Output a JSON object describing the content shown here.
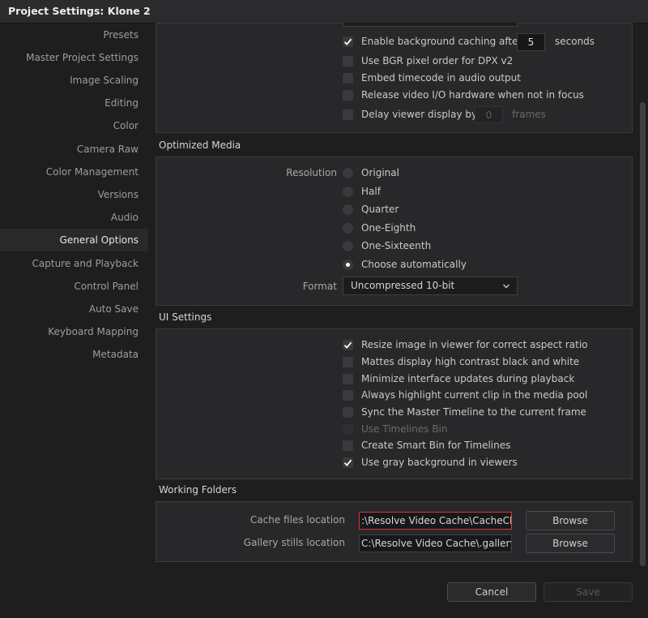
{
  "window": {
    "title": "Project Settings:  Klone 2"
  },
  "sidebar": {
    "items": [
      {
        "label": "Presets",
        "active": false
      },
      {
        "label": "Master Project Settings",
        "active": false
      },
      {
        "label": "Image Scaling",
        "active": false
      },
      {
        "label": "Editing",
        "active": false
      },
      {
        "label": "Color",
        "active": false
      },
      {
        "label": "Camera Raw",
        "active": false
      },
      {
        "label": "Color Management",
        "active": false
      },
      {
        "label": "Versions",
        "active": false
      },
      {
        "label": "Audio",
        "active": false
      },
      {
        "label": "General Options",
        "active": true
      },
      {
        "label": "Capture and Playback",
        "active": false
      },
      {
        "label": "Control Panel",
        "active": false
      },
      {
        "label": "Auto Save",
        "active": false
      },
      {
        "label": "Keyboard Mapping",
        "active": false
      },
      {
        "label": "Metadata",
        "active": false
      }
    ]
  },
  "general": {
    "bg_caching": {
      "label": "Enable background caching after",
      "checked": true,
      "value": "5",
      "unit": "seconds"
    },
    "bgr_order": {
      "label": "Use BGR pixel order for DPX v2",
      "checked": false
    },
    "embed_tc": {
      "label": "Embed timecode in audio output",
      "checked": false
    },
    "release_io": {
      "label": "Release video I/O hardware when not in focus",
      "checked": false
    },
    "delay_viewer": {
      "label": "Delay viewer display by",
      "checked": false,
      "value": "0",
      "unit": "frames"
    }
  },
  "optimized_media": {
    "title": "Optimized Media",
    "resolution_label": "Resolution",
    "options": [
      {
        "label": "Original",
        "checked": false
      },
      {
        "label": "Half",
        "checked": false
      },
      {
        "label": "Quarter",
        "checked": false
      },
      {
        "label": "One-Eighth",
        "checked": false
      },
      {
        "label": "One-Sixteenth",
        "checked": false
      },
      {
        "label": "Choose automatically",
        "checked": true
      }
    ],
    "format_label": "Format",
    "format_value": "Uncompressed 10-bit"
  },
  "ui_settings": {
    "title": "UI Settings",
    "items": [
      {
        "label": "Resize image in viewer for correct aspect ratio",
        "checked": true,
        "disabled": false
      },
      {
        "label": "Mattes display high contrast black and white",
        "checked": false,
        "disabled": false
      },
      {
        "label": "Minimize interface updates during playback",
        "checked": false,
        "disabled": false
      },
      {
        "label": "Always highlight current clip in the media pool",
        "checked": false,
        "disabled": false
      },
      {
        "label": "Sync the Master Timeline to the current frame",
        "checked": false,
        "disabled": false
      },
      {
        "label": "Use Timelines Bin",
        "checked": false,
        "disabled": true
      },
      {
        "label": "Create Smart Bin for Timelines",
        "checked": false,
        "disabled": false
      },
      {
        "label": "Use gray background in viewers",
        "checked": true,
        "disabled": false
      }
    ]
  },
  "working_folders": {
    "title": "Working Folders",
    "cache": {
      "label": "Cache files location",
      "value": ":\\Resolve Video Cache\\CacheClip",
      "button": "Browse"
    },
    "gallery": {
      "label": "Gallery stills location",
      "value": "C:\\Resolve Video Cache\\.gallery",
      "button": "Browse"
    }
  },
  "footer": {
    "cancel": "Cancel",
    "save": "Save"
  },
  "colors": {
    "accent_focus": "#d43838",
    "background": "#1e1e1f",
    "panel": "#28282a"
  }
}
